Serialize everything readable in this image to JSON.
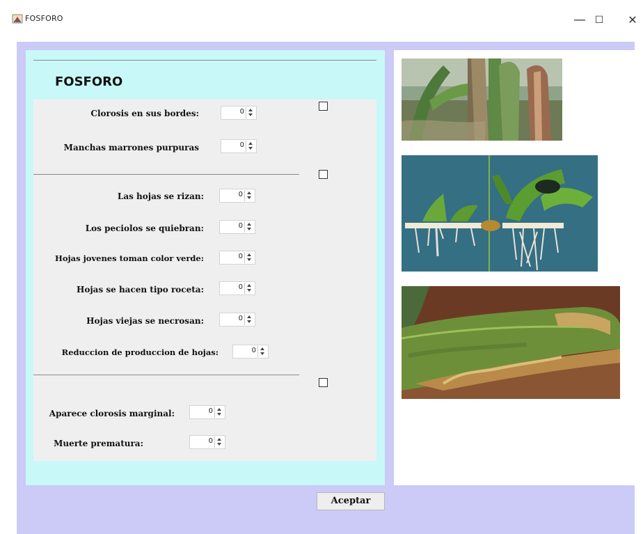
{
  "window": {
    "title": "FOSFORO",
    "minimize_glyph": "—",
    "maximize_glyph": "☐",
    "close_glyph": "✕"
  },
  "form": {
    "heading": "FOSFORO",
    "group1": {
      "fields": [
        {
          "label": "Clorosis en sus bordes:",
          "value": "0"
        },
        {
          "label": "Manchas marrones purpuras",
          "value": "0"
        }
      ]
    },
    "group2": {
      "fields": [
        {
          "label": "Las hojas se rizan:",
          "value": "0"
        },
        {
          "label": "Los peciolos se quiebran:",
          "value": "0"
        },
        {
          "label": "Hojas jovenes toman color verde:",
          "value": "0"
        },
        {
          "label": "Hojas se hacen tipo roceta:",
          "value": "0"
        },
        {
          "label": "Hojas viejas se necrosan:",
          "value": "0"
        },
        {
          "label": "Reduccion de produccion de hojas:",
          "value": "0"
        }
      ]
    },
    "group3": {
      "fields": [
        {
          "label": "Aparece clorosis marginal:",
          "value": "0"
        },
        {
          "label": "Muerte prematura:",
          "value": "0"
        }
      ]
    }
  },
  "images": [
    {
      "name": "banana-plants-photo"
    },
    {
      "name": "hydroponic-roots-photo"
    },
    {
      "name": "necrotic-leaf-photo"
    }
  ],
  "footer": {
    "accept_label": "Aceptar"
  },
  "colors": {
    "frame": "#cccaf7",
    "left_panel": "#c9f8f8",
    "section": "#efefef"
  }
}
